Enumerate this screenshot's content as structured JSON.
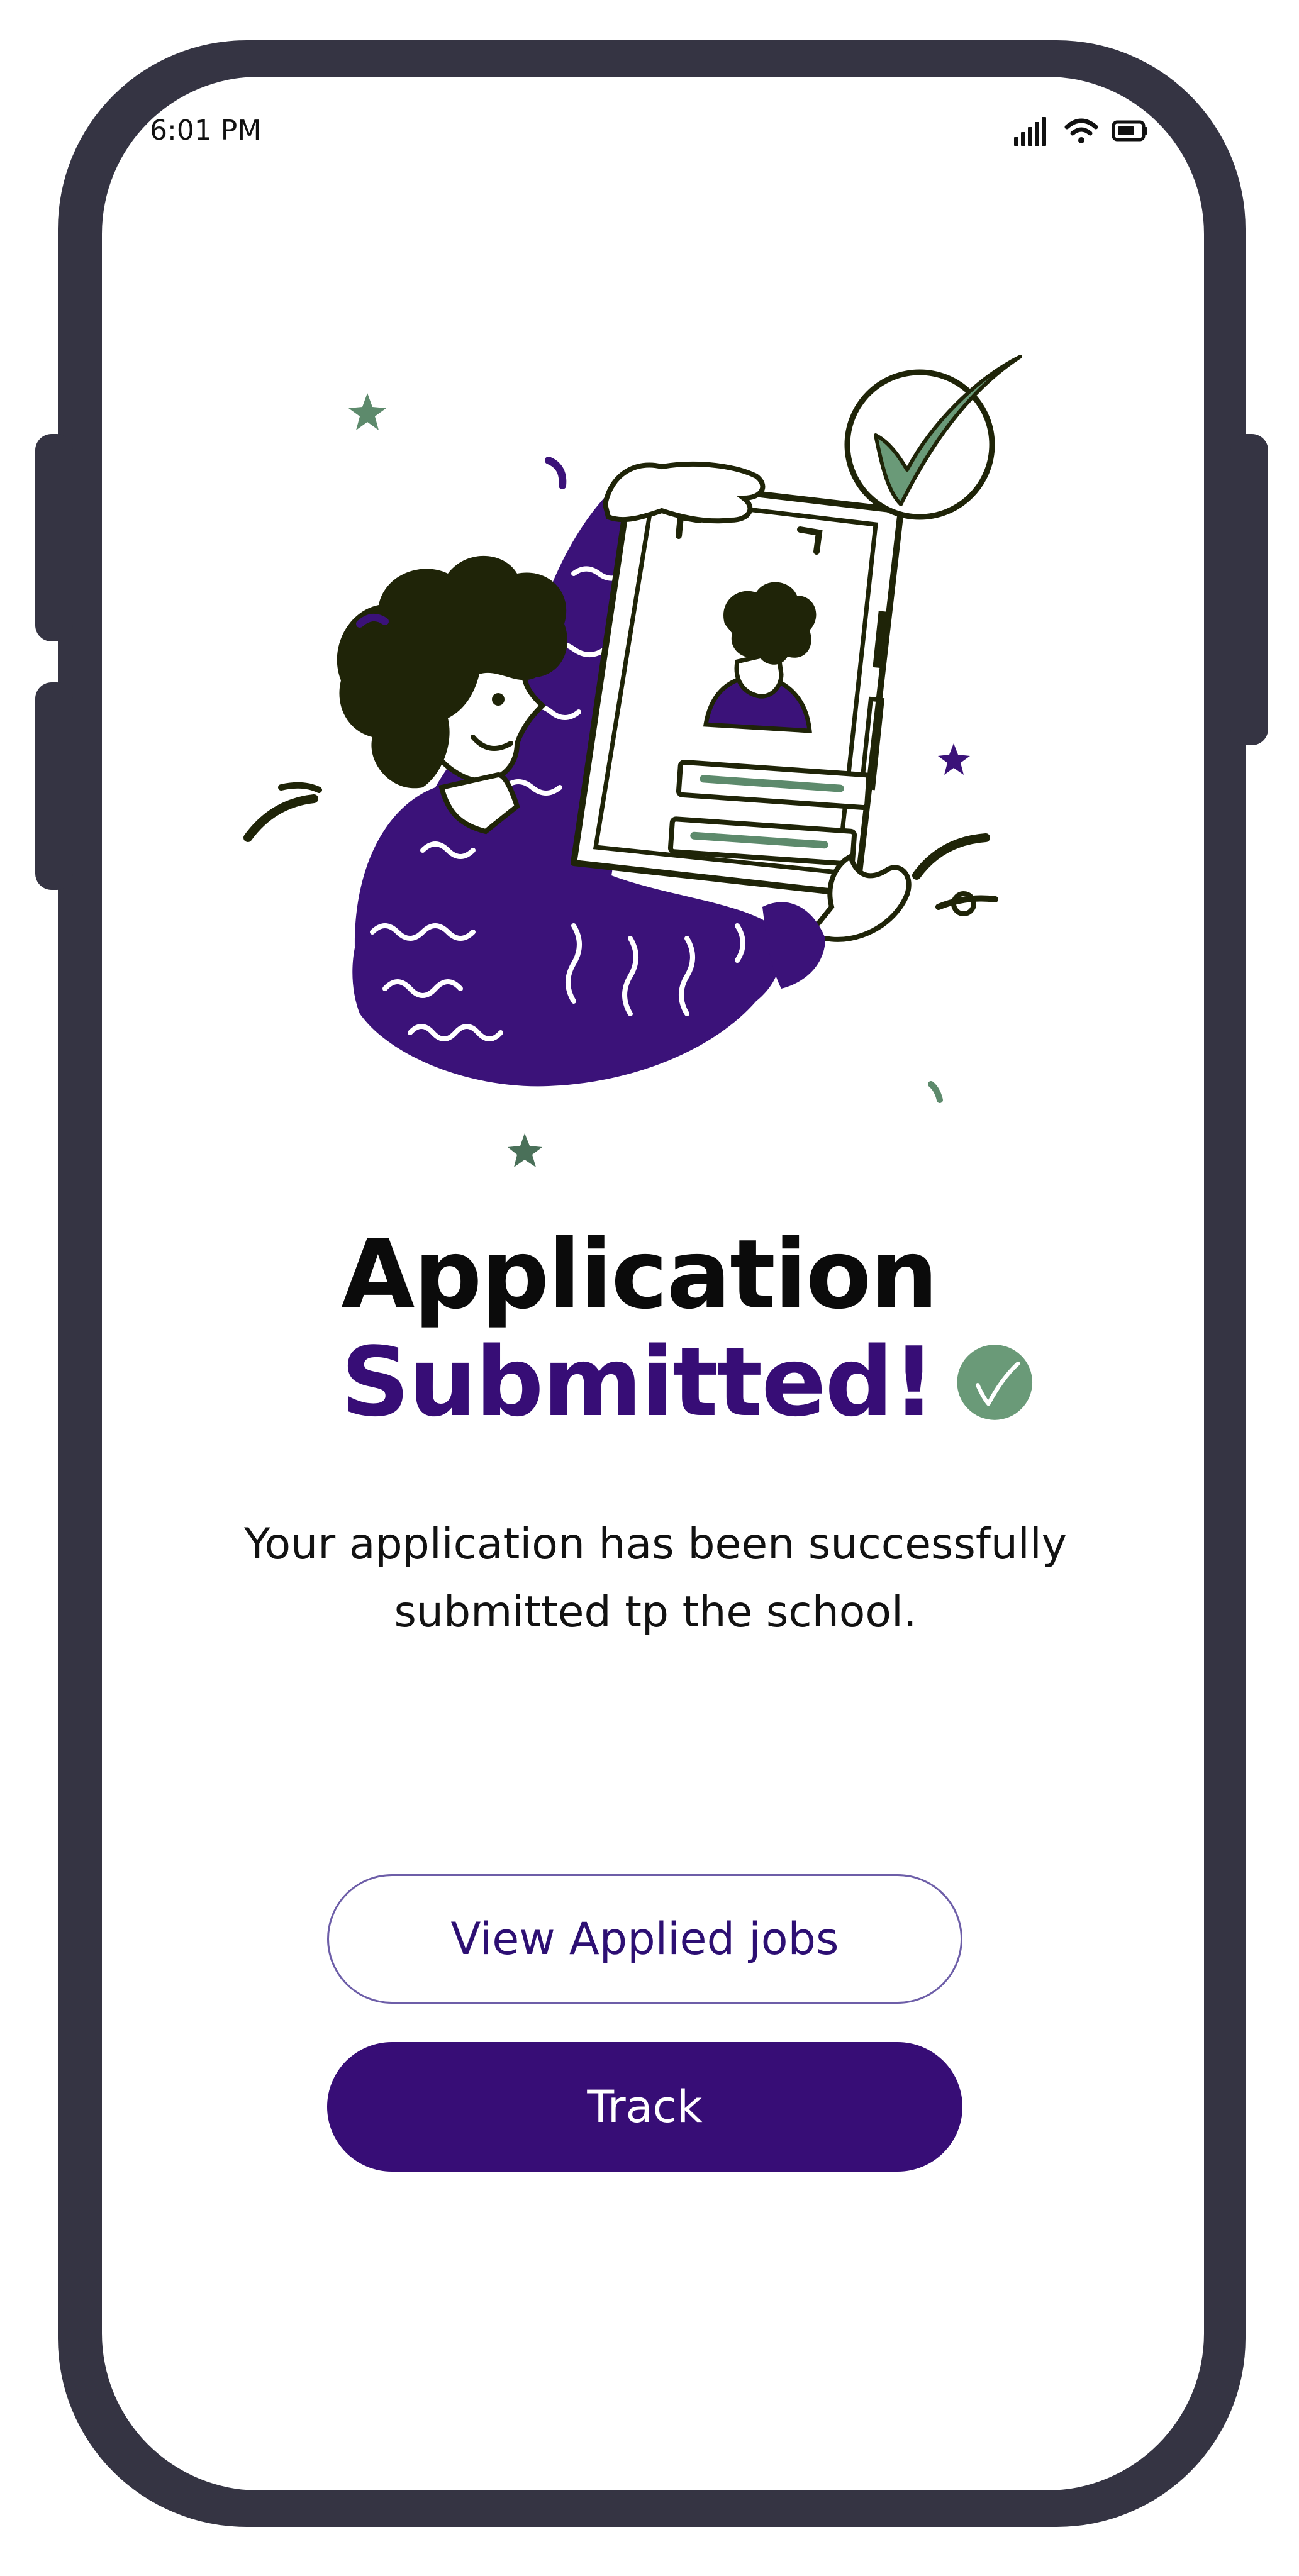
{
  "status_bar": {
    "time": "6:01 PM",
    "icons": [
      "signal-icon",
      "wifi-icon",
      "battery-icon"
    ]
  },
  "illustration": {
    "description_icon": "person-holding-document-illustration"
  },
  "title": {
    "line1": "Application",
    "line2": "Submitted!"
  },
  "message": "Your application has been successfully submitted tp the school.",
  "buttons": {
    "view_applied": "View Applied jobs",
    "track": "Track"
  },
  "colors": {
    "frame": "#353443",
    "primary": "#370d76",
    "accent_green": "#6a9a78",
    "ink": "#1f2408"
  }
}
